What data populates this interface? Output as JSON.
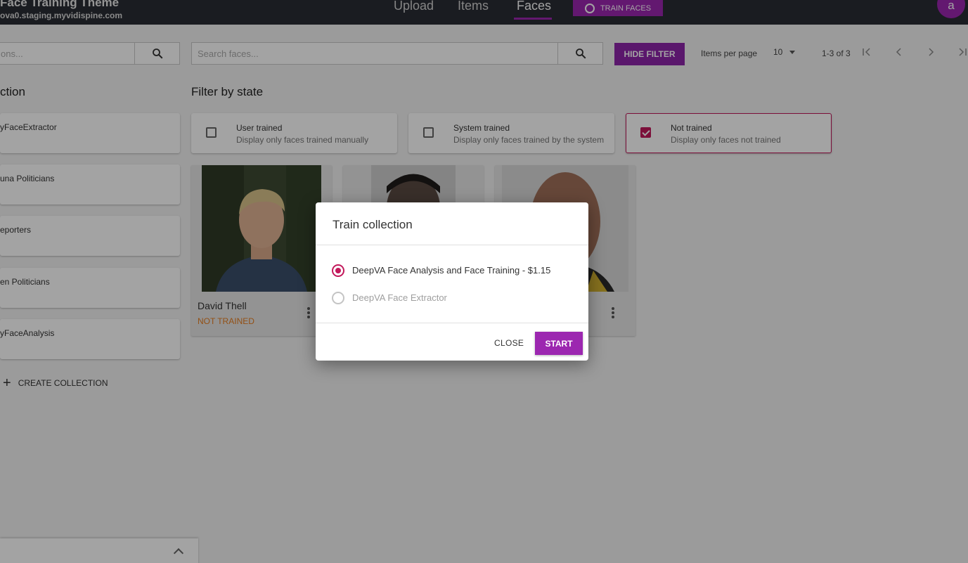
{
  "header": {
    "app_title": "Face Training Theme",
    "host": "ova0.staging.myvidispine.com",
    "nav": [
      "Upload",
      "Items",
      "Faces"
    ],
    "active_tab": "Faces",
    "train_faces_label": "TRAIN FACES",
    "avatar_letter": "a"
  },
  "toolbar": {
    "collection_search_placeholder": "ons...",
    "face_search_placeholder": "Search faces...",
    "hide_filter_label": "HIDE FILTER",
    "items_per_page_label": "Items per page",
    "items_per_page_value": "10",
    "range_label": "1-3 of 3"
  },
  "collections": {
    "title": "ction",
    "items": [
      "yFaceExtractor",
      "una Politicians",
      "eporters",
      "en Politicians",
      "yFaceAnalysis"
    ],
    "create_label": "CREATE COLLECTION"
  },
  "filter": {
    "title": "Filter by state",
    "options": [
      {
        "title": "User trained",
        "desc": "Display only faces trained manually",
        "checked": false
      },
      {
        "title": "System trained",
        "desc": "Display only faces trained by the system",
        "checked": false
      },
      {
        "title": "Not trained",
        "desc": "Display only faces not trained",
        "checked": true
      }
    ]
  },
  "faces": [
    {
      "name": "David Thell",
      "status": "NOT TRAINED"
    },
    {
      "name": "",
      "status": ""
    },
    {
      "name": "",
      "status": ""
    }
  ],
  "dialog": {
    "title": "Train collection",
    "options": [
      {
        "label": "DeepVA Face Analysis and Face Training - $1.15",
        "selected": true,
        "enabled": true
      },
      {
        "label": "DeepVA Face Extractor",
        "selected": false,
        "enabled": false
      }
    ],
    "close_label": "CLOSE",
    "start_label": "START"
  },
  "colors": {
    "accent": "#9c27b0",
    "selected": "#c2185b",
    "status_not_trained": "#e67e22",
    "topbar": "#2a2c34"
  }
}
